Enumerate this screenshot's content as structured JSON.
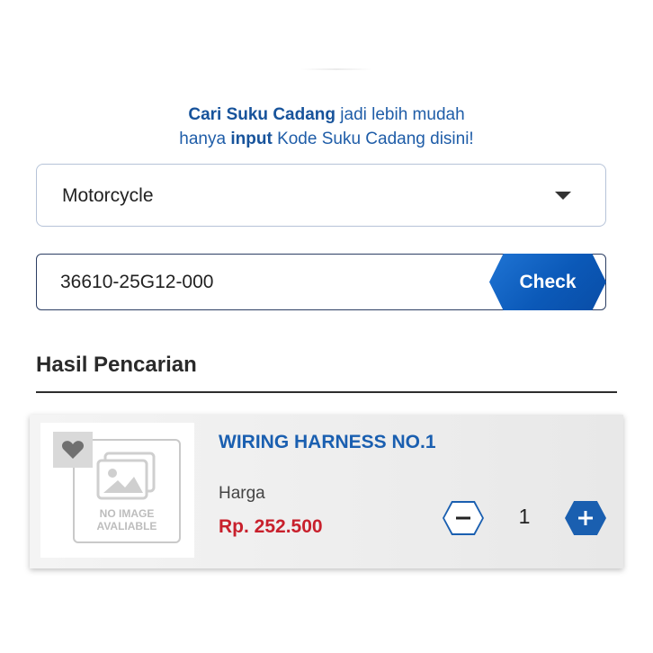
{
  "intro": {
    "line1_bold": "Cari Suku Cadang",
    "line1_rest": "jadi lebih mudah",
    "line2_start": "hanya",
    "line2_bold": "input",
    "line2_rest": "Kode Suku Cadang disini!"
  },
  "vehicle_select": {
    "selected": "Motorcycle"
  },
  "part_search": {
    "value": "36610-25G12-000",
    "check_label": "Check"
  },
  "results": {
    "title": "Hasil Pencarian",
    "items": [
      {
        "name": "WIRING HARNESS NO.1",
        "price_label": "Harga",
        "price": "Rp. 252.500",
        "quantity": "1",
        "image_placeholder": "NO IMAGE AVALIABLE"
      }
    ]
  },
  "icons": {
    "dropdown": "chevron-down-icon",
    "favorite": "heart-icon",
    "placeholder": "image-placeholder-icon",
    "decrease": "minus-icon",
    "increase": "plus-icon"
  },
  "colors": {
    "brand_blue": "#1a5fb0",
    "price_red": "#c8202c",
    "check_button": "#0b59b8"
  }
}
